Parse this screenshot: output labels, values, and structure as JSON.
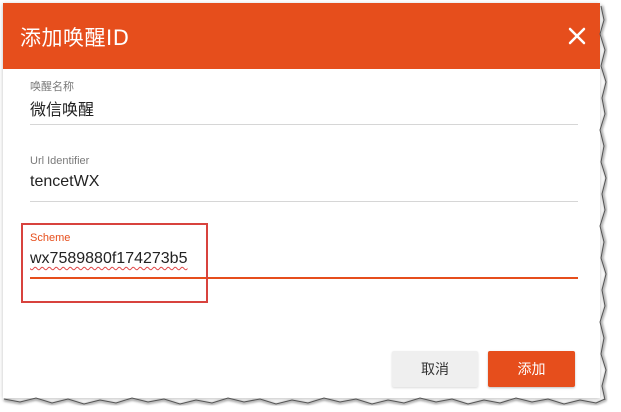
{
  "dialog": {
    "title": "添加唤醒ID",
    "close_icon": "close-icon",
    "accent_color": "#e64e1c"
  },
  "fields": [
    {
      "label": "唤醒名称",
      "value": "微信唤醒"
    },
    {
      "label": "Url Identifier",
      "value": "tencetWX"
    },
    {
      "label": "Scheme",
      "value": "wx7589880f174273b5",
      "active": true
    }
  ],
  "buttons": {
    "cancel": "取消",
    "add": "添加"
  },
  "annotation": {
    "highlight_color": "#d8433e"
  }
}
